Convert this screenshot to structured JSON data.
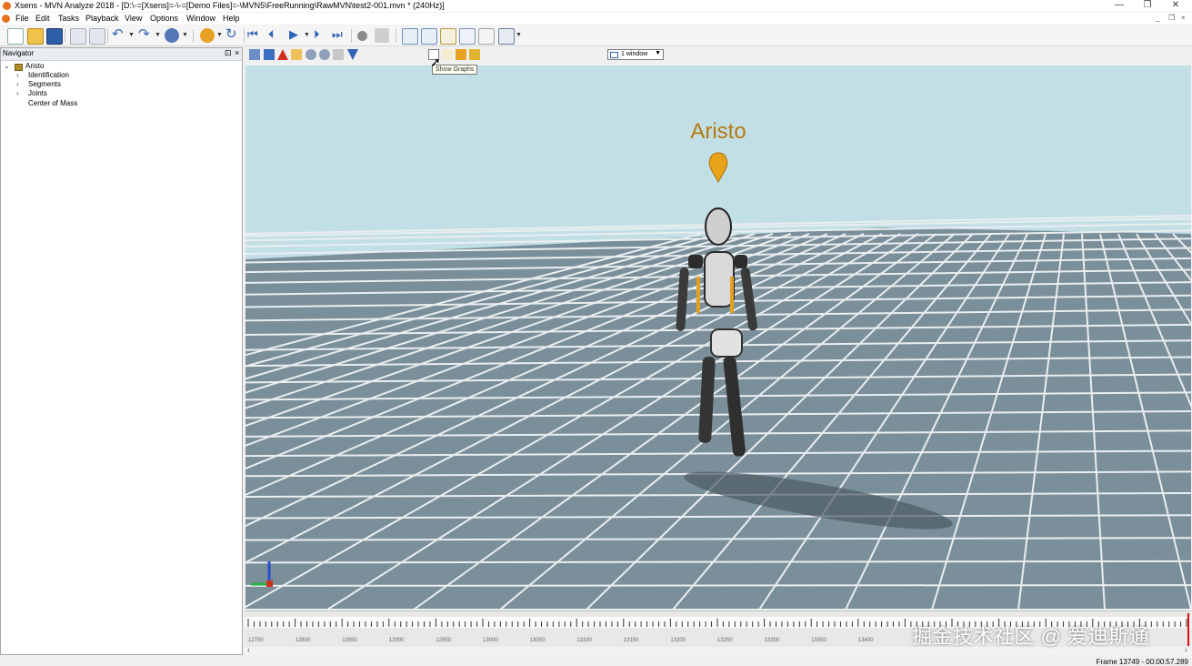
{
  "window": {
    "title": "Xsens - MVN Analyze 2018 - [D:\\-=[Xsens]=-\\-=[Demo Files]=-\\MVN5\\FreeRunning\\RawMVN\\test2-001.mvn * (240Hz)]",
    "minimize_glyph": "—",
    "restore_glyph": "❐",
    "close_glyph": "✕"
  },
  "menu": [
    "File",
    "Edit",
    "Tasks",
    "Playback",
    "View",
    "Options",
    "Window",
    "Help"
  ],
  "mdi_controls": [
    "_",
    "❐",
    "×"
  ],
  "navigator": {
    "title": "Navigator",
    "pin_glyph": "⊡",
    "close_glyph": "×",
    "root": "Aristo",
    "children": [
      "Identification",
      "Segments",
      "Joints",
      "Center of Mass"
    ]
  },
  "viewer": {
    "window_select": "1 window",
    "tooltip": "Show Graphs",
    "character_name": "Aristo"
  },
  "timeline": {
    "tick_labels": [
      "12750",
      "12800",
      "12850",
      "12900",
      "12950",
      "13000",
      "13050",
      "13100",
      "13150",
      "13200",
      "13250",
      "13300",
      "13350",
      "13400"
    ],
    "left_arrow": "‹",
    "right_arrow": "›"
  },
  "status": {
    "frame": "Frame 13749 - 00:00:57.289"
  },
  "watermark": "掘金技术社区 @ 爱迪斯通",
  "colors": {
    "sky": "#c3dfe6",
    "floor": "#7b8f9a",
    "grid": "#e9eef0",
    "character_name": "#b37a10",
    "accent_orange": "#e8721c"
  }
}
